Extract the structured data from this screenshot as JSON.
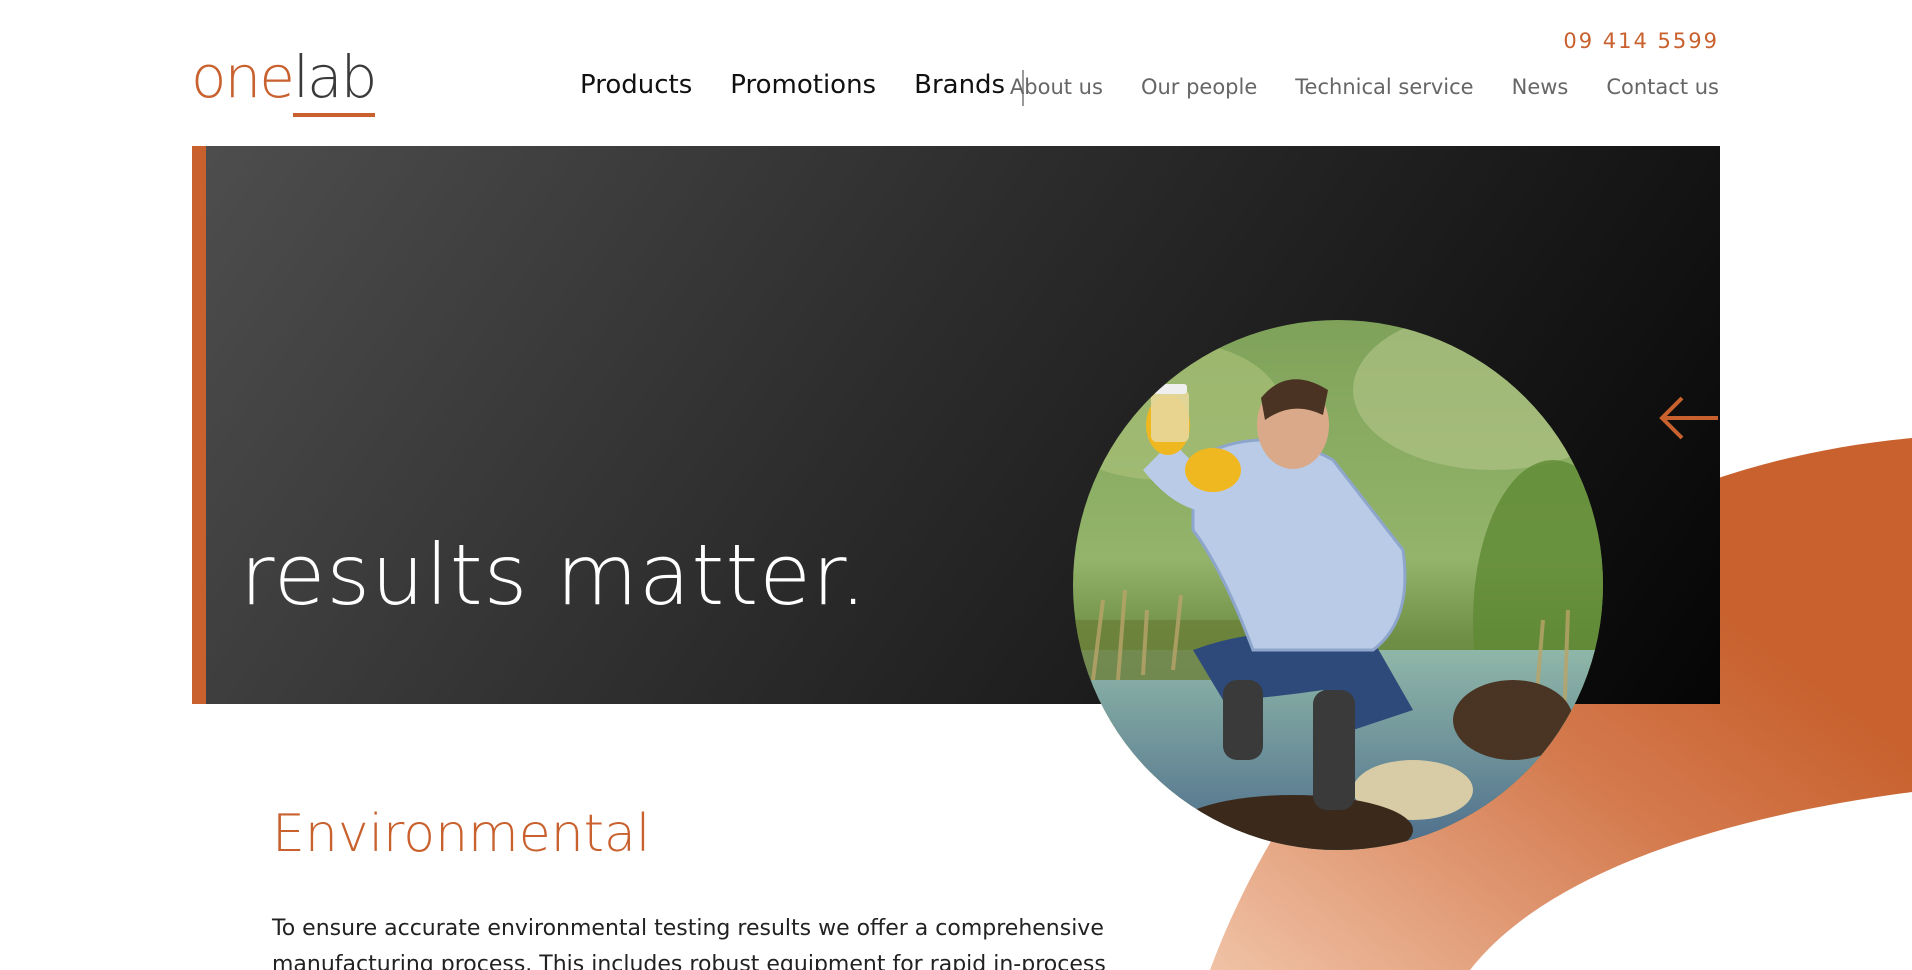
{
  "brand": {
    "logo_one": "one",
    "logo_lab": "lab",
    "accent_color": "#c8612e"
  },
  "header": {
    "phone": "09 414 5599",
    "nav_primary": [
      {
        "label": "Products"
      },
      {
        "label": "Promotions"
      },
      {
        "label": "Brands"
      }
    ],
    "nav_secondary": [
      {
        "label": "About us"
      },
      {
        "label": "Our people"
      },
      {
        "label": "Technical service"
      },
      {
        "label": "News"
      },
      {
        "label": "Contact us"
      }
    ]
  },
  "hero": {
    "title": "results matter.",
    "prev_icon": "arrow-left-icon",
    "next_icon": "arrow-right-icon"
  },
  "section": {
    "title": "Environmental",
    "body": "To ensure accurate environmental testing results we offer a comprehensive manufacturing process. This includes robust equipment for rapid in-process"
  }
}
